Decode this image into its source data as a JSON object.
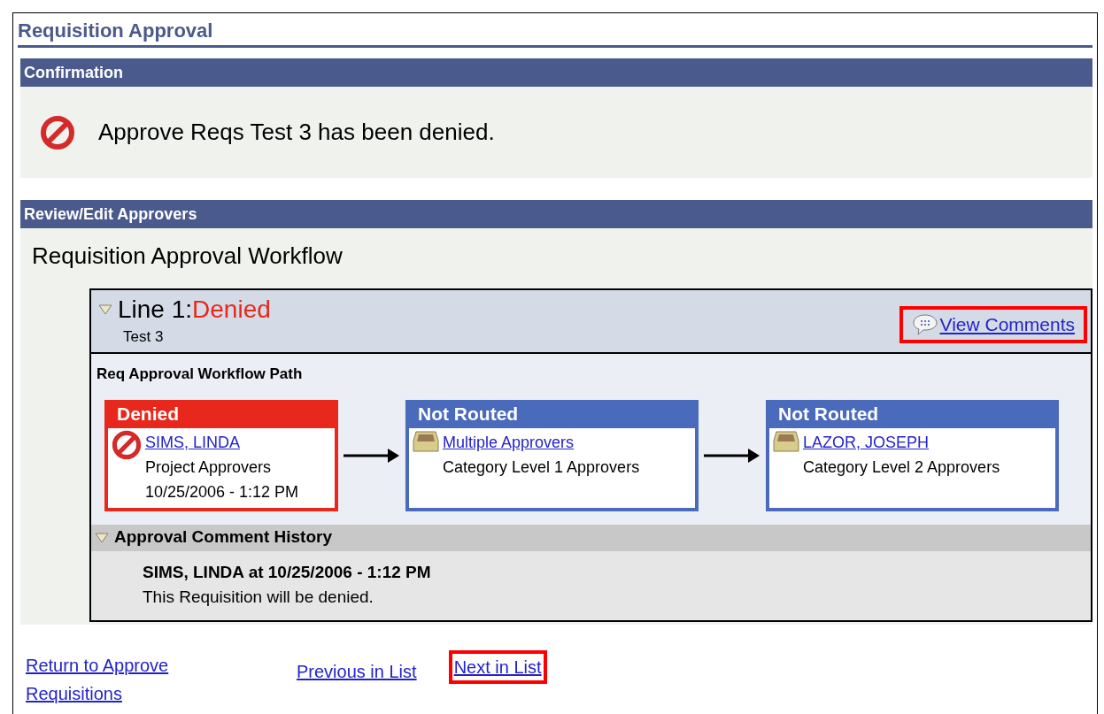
{
  "page_title": "Requisition Approval",
  "confirmation": {
    "header": "Confirmation",
    "kind": "denied",
    "message": "Approve Reqs Test 3 has been denied."
  },
  "review": {
    "header": "Review/Edit Approvers",
    "heading": "Requisition Approval Workflow",
    "line": {
      "expanded": true,
      "label": "Line 1:",
      "status": "Denied",
      "description": "Test 3",
      "view_comments": {
        "label": "View Comments",
        "highlighted": true
      },
      "path_title": "Req Approval Workflow Path",
      "stages": [
        {
          "kind": "denied",
          "status": "Denied",
          "approver": "SIMS, LINDA",
          "group": "Project Approvers",
          "time": "10/25/2006 - 1:12 PM"
        },
        {
          "kind": "not_routed",
          "status": "Not Routed",
          "approver": "Multiple Approvers",
          "group": "Category Level 1 Approvers"
        },
        {
          "kind": "not_routed",
          "status": "Not Routed",
          "approver": "LAZOR, JOSEPH",
          "group": "Category Level 2 Approvers"
        }
      ],
      "comment_history": {
        "expanded": true,
        "title": "Approval Comment History",
        "author_line": "SIMS, LINDA at 10/25/2006 - 1:12 PM",
        "comment": "This Requisition will be denied."
      }
    }
  },
  "footer_links": [
    {
      "label": "Return to Approve Requisitions",
      "highlighted": false
    },
    {
      "label": "Previous in List",
      "highlighted": false
    },
    {
      "label": "Next in List",
      "highlighted": true
    }
  ]
}
